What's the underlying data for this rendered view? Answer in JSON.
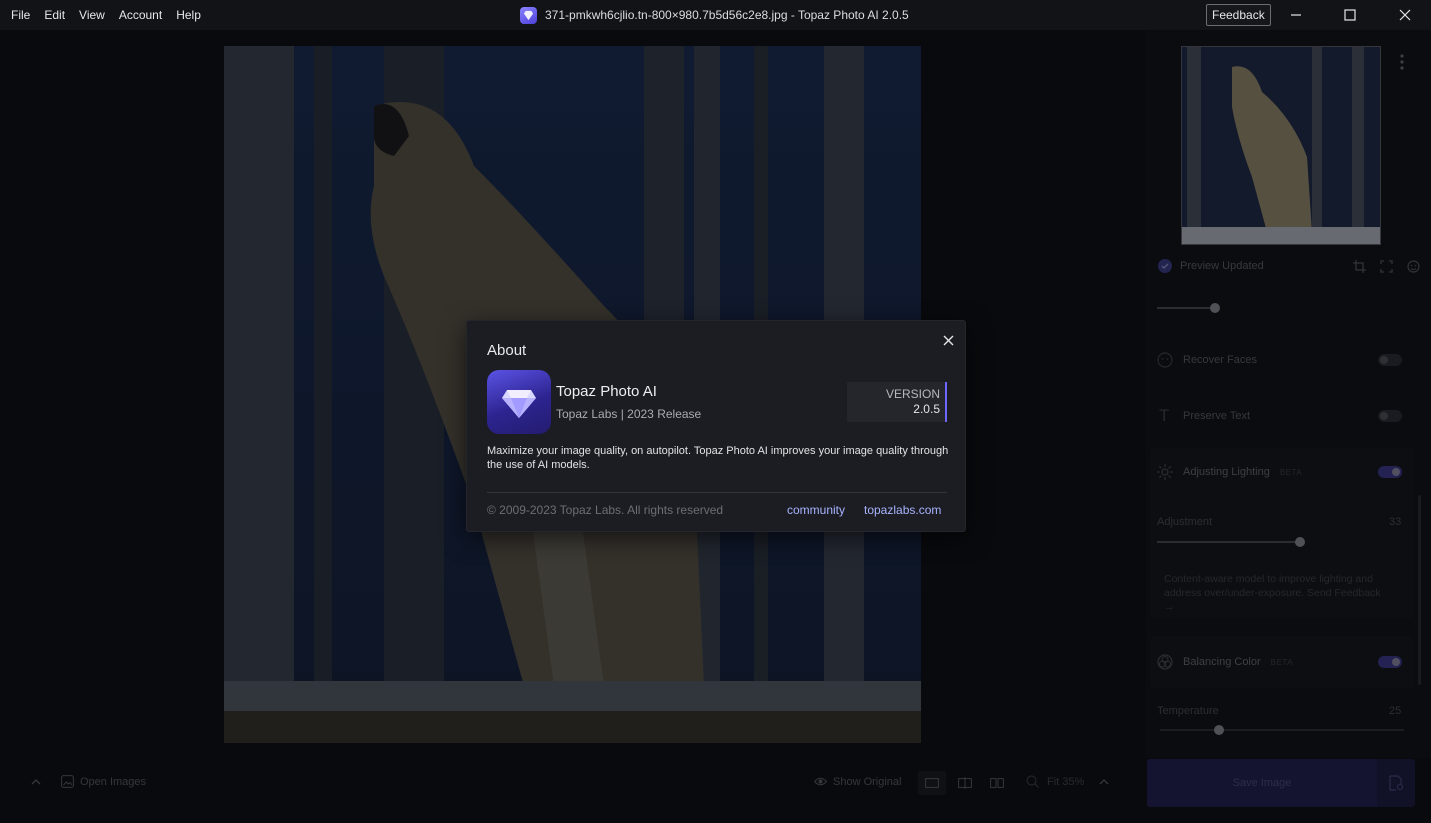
{
  "menu": {
    "items": [
      "File",
      "Edit",
      "View",
      "Account",
      "Help"
    ]
  },
  "window": {
    "title": "371-pmkwh6cjlio.tn-800×980.7b5d56c2e8.jpg - Topaz Photo AI 2.0.5"
  },
  "header": {
    "feedback_label": "Feedback"
  },
  "panel": {
    "preview_status": "Preview Updated",
    "recover_faces": {
      "label": "Recover Faces",
      "enabled": false
    },
    "preserve_text": {
      "label": "Preserve Text",
      "enabled": false
    },
    "adjusting_lighting": {
      "label": "Adjusting Lighting",
      "badge": "BETA",
      "enabled": true
    },
    "adjustment": {
      "label": "Adjustment",
      "value": "33"
    },
    "lighting_help": "Content-aware model to improve lighting and address over/under-exposure. Send Feedback →",
    "balancing_color": {
      "label": "Balancing Color",
      "badge": "BETA",
      "enabled": true
    },
    "temperature": {
      "label": "Temperature",
      "value": "25"
    }
  },
  "bottom": {
    "open_images": "Open Images",
    "show_original": "Show Original",
    "zoom_label": "Fit 35%",
    "save_label": "Save Image"
  },
  "about_dialog": {
    "title": "About",
    "app_name": "Topaz Photo AI",
    "vendor": "Topaz Labs | 2023 Release",
    "version_label": "VERSION",
    "version": "2.0.5",
    "description": "Maximize your image quality, on autopilot. Topaz Photo AI improves your image quality through the use of AI models.",
    "copyright": "© 2009-2023 Topaz Labs. All rights reserved",
    "link_community": "community",
    "link_site": "topazlabs.com"
  },
  "colors": {
    "accent": "#6d66ff",
    "link": "#a8b3ff",
    "background": "#0d0e11"
  }
}
